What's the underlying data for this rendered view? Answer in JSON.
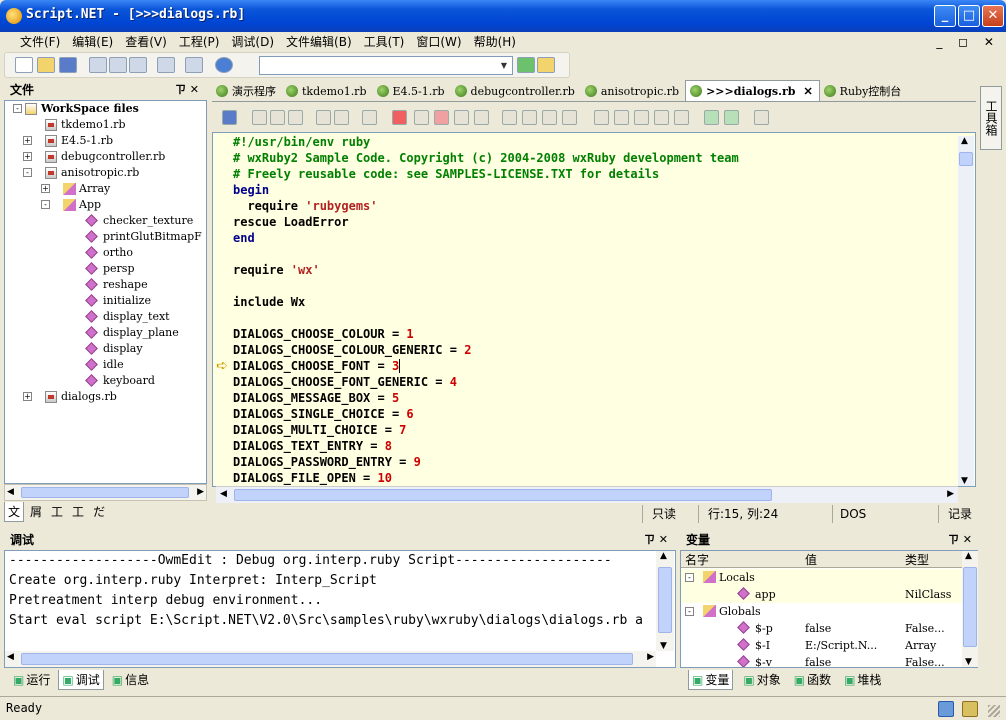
{
  "window": {
    "title": "Script.NET - [>>>dialogs.rb]",
    "controls": {
      "minimize": "_",
      "maximize": "□",
      "close": "✕"
    }
  },
  "menu": [
    "文件(F)",
    "编辑(E)",
    "查看(V)",
    "工程(P)",
    "调试(D)",
    "文件编辑(B)",
    "工具(T)",
    "窗口(W)",
    "帮助(H)"
  ],
  "mdi_controls": "_ ◻ ✕",
  "file_panel": {
    "title": "文件",
    "pin": "ㄗ ✕",
    "tree": [
      {
        "label": "WorkSpace files",
        "level": 0,
        "exp": "-",
        "icon": "workspace"
      },
      {
        "label": "tkdemo1.rb",
        "level": 1,
        "exp": "",
        "icon": "file"
      },
      {
        "label": "E4.5-1.rb",
        "level": 1,
        "exp": "+",
        "icon": "file"
      },
      {
        "label": "debugcontroller.rb",
        "level": 1,
        "exp": "+",
        "icon": "file"
      },
      {
        "label": "anisotropic.rb",
        "level": 1,
        "exp": "-",
        "icon": "file"
      },
      {
        "label": "Array",
        "level": 2,
        "exp": "+",
        "icon": "class"
      },
      {
        "label": "App",
        "level": 2,
        "exp": "-",
        "icon": "class"
      },
      {
        "label": "checker_texture",
        "level": 3,
        "exp": "",
        "icon": "method"
      },
      {
        "label": "printGlutBitmapF",
        "level": 3,
        "exp": "",
        "icon": "method"
      },
      {
        "label": "ortho",
        "level": 3,
        "exp": "",
        "icon": "method"
      },
      {
        "label": "persp",
        "level": 3,
        "exp": "",
        "icon": "method"
      },
      {
        "label": "reshape",
        "level": 3,
        "exp": "",
        "icon": "method"
      },
      {
        "label": "initialize",
        "level": 3,
        "exp": "",
        "icon": "method"
      },
      {
        "label": "display_text",
        "level": 3,
        "exp": "",
        "icon": "method"
      },
      {
        "label": "display_plane",
        "level": 3,
        "exp": "",
        "icon": "method"
      },
      {
        "label": "display",
        "level": 3,
        "exp": "",
        "icon": "method"
      },
      {
        "label": "idle",
        "level": 3,
        "exp": "",
        "icon": "method"
      },
      {
        "label": "keyboard",
        "level": 3,
        "exp": "",
        "icon": "method"
      },
      {
        "label": "dialogs.rb",
        "level": 1,
        "exp": "+",
        "icon": "file"
      }
    ],
    "tabs": [
      "文",
      "屑",
      "工",
      "工",
      "だ"
    ]
  },
  "doc_tabs": [
    {
      "label": "演示程序",
      "active": false
    },
    {
      "label": "tkdemo1.rb",
      "active": false
    },
    {
      "label": "E4.5-1.rb",
      "active": false
    },
    {
      "label": "debugcontroller.rb",
      "active": false
    },
    {
      "label": "anisotropic.rb",
      "active": false
    },
    {
      "label": ">>>dialogs.rb",
      "active": true
    },
    {
      "label": "Ruby控制台",
      "active": false
    }
  ],
  "doc_tab_close": "✕",
  "code": [
    [
      [
        "cmt",
        "#!/usr/bin/env ruby"
      ]
    ],
    [
      [
        "cmt",
        "# wxRuby2 Sample Code. Copyright (c) 2004-2008 wxRuby development team"
      ]
    ],
    [
      [
        "cmt",
        "# Freely reusable code: see SAMPLES-LICENSE.TXT for details"
      ]
    ],
    [
      [
        "kw",
        "begin"
      ]
    ],
    [
      [
        "id",
        "  require "
      ],
      [
        "str",
        "'rubygems'"
      ]
    ],
    [
      [
        "id",
        "rescue LoadError"
      ]
    ],
    [
      [
        "kw",
        "end"
      ]
    ],
    [],
    [
      [
        "id",
        "require "
      ],
      [
        "str",
        "'wx'"
      ]
    ],
    [],
    [
      [
        "id",
        "include Wx"
      ]
    ],
    [],
    [
      [
        "id",
        "DIALOGS_CHOOSE_COLOUR = "
      ],
      [
        "num",
        "1"
      ]
    ],
    [
      [
        "id",
        "DIALOGS_CHOOSE_COLOUR_GENERIC = "
      ],
      [
        "num",
        "2"
      ]
    ],
    [
      [
        "id",
        "DIALOGS_CHOOSE_FONT = "
      ],
      [
        "num",
        "3"
      ]
    ],
    [
      [
        "id",
        "DIALOGS_CHOOSE_FONT_GENERIC = "
      ],
      [
        "num",
        "4"
      ]
    ],
    [
      [
        "id",
        "DIALOGS_MESSAGE_BOX = "
      ],
      [
        "num",
        "5"
      ]
    ],
    [
      [
        "id",
        "DIALOGS_SINGLE_CHOICE = "
      ],
      [
        "num",
        "6"
      ]
    ],
    [
      [
        "id",
        "DIALOGS_MULTI_CHOICE = "
      ],
      [
        "num",
        "7"
      ]
    ],
    [
      [
        "id",
        "DIALOGS_TEXT_ENTRY = "
      ],
      [
        "num",
        "8"
      ]
    ],
    [
      [
        "id",
        "DIALOGS_PASSWORD_ENTRY = "
      ],
      [
        "num",
        "9"
      ]
    ],
    [
      [
        "id",
        "DIALOGS_FILE_OPEN = "
      ],
      [
        "num",
        "10"
      ]
    ]
  ],
  "editor_status": {
    "mode": "只读",
    "position": "行:15, 列:24",
    "format": "DOS",
    "record": "记录"
  },
  "right_strip_tab": "工具箱",
  "debug_panel": {
    "title": "调试",
    "pin": "ㄗ ✕",
    "lines": [
      "-------------------OwmEdit : Debug org.interp.ruby Script--------------------",
      "Create org.interp.ruby Interpret: Interp_Script",
      "Pretreatment interp debug environment...",
      "Start eval script E:\\Script.NET\\V2.0\\Src\\samples\\ruby\\wxruby\\dialogs\\dialogs.rb a"
    ],
    "tabs": [
      "运行",
      "调试",
      "信息"
    ]
  },
  "var_panel": {
    "title": "变量",
    "pin": "ㄗ ✕",
    "columns": [
      "名字",
      "值",
      "类型"
    ],
    "rows": [
      {
        "name": "Locals",
        "value": "",
        "type": "",
        "level": 0,
        "exp": "-",
        "selected": true
      },
      {
        "name": "app",
        "value": "",
        "type": "NilClass",
        "level": 1,
        "exp": "",
        "selected": true
      },
      {
        "name": "Globals",
        "value": "",
        "type": "",
        "level": 0,
        "exp": "-",
        "selected": false
      },
      {
        "name": "$-p",
        "value": "false",
        "type": "False...",
        "level": 1,
        "exp": "",
        "selected": false
      },
      {
        "name": "$-I",
        "value": "E:/Script.N...",
        "type": "Array",
        "level": 1,
        "exp": "",
        "selected": false
      },
      {
        "name": "$-v",
        "value": "false",
        "type": "False...",
        "level": 1,
        "exp": "",
        "selected": false
      }
    ],
    "tabs": [
      "变量",
      "对象",
      "函数",
      "堆栈"
    ]
  },
  "status": {
    "text": "Ready"
  },
  "colors": {
    "title_blue": "#0046d5",
    "editor_bg": "#ffffe1",
    "comment": "#008000",
    "keyword": "#00008b",
    "string": "#b22222"
  }
}
